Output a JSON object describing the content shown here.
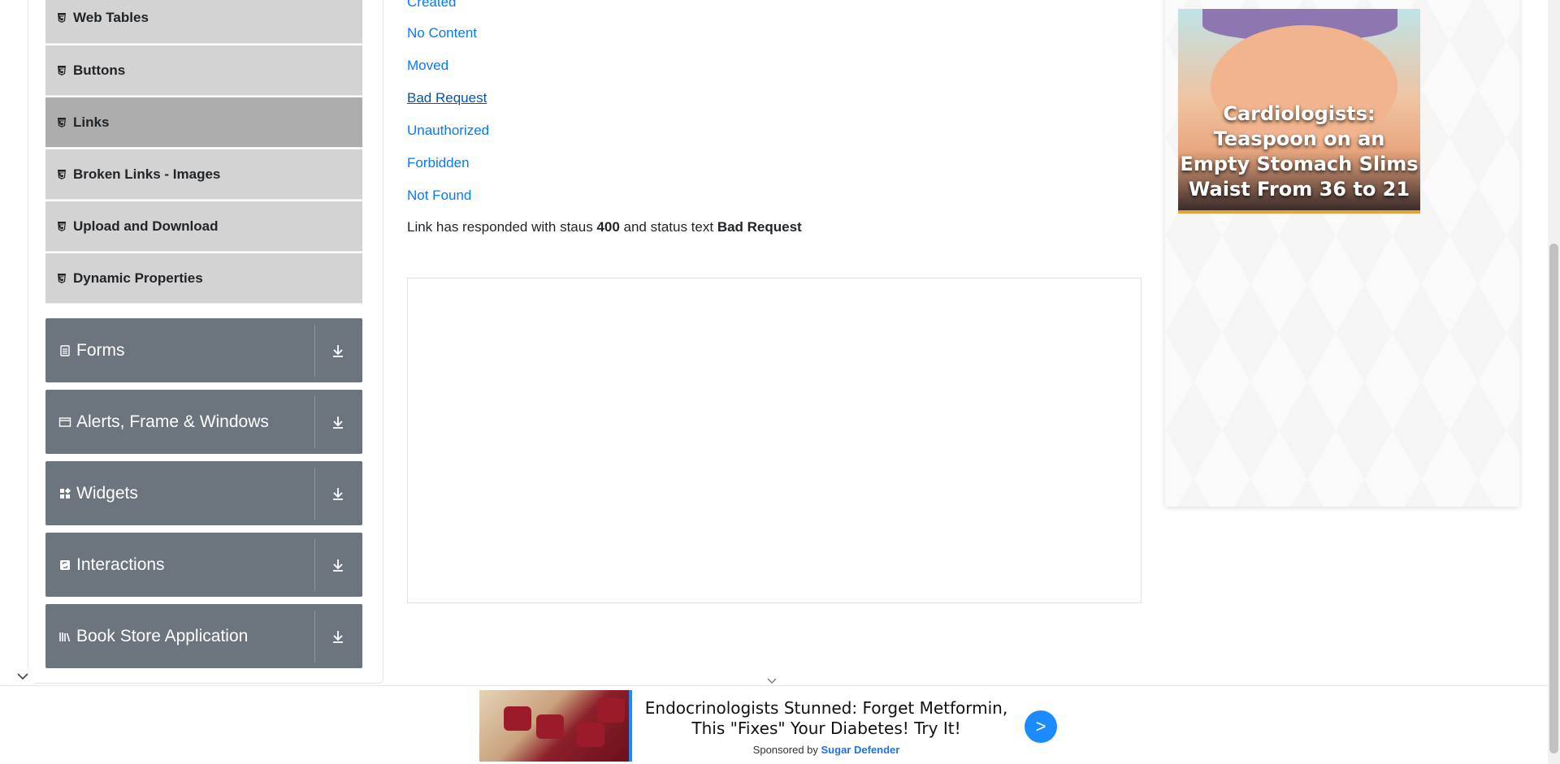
{
  "sidebar": {
    "items": [
      {
        "label": "Web Tables"
      },
      {
        "label": "Buttons"
      },
      {
        "label": "Links"
      },
      {
        "label": "Broken Links - Images"
      },
      {
        "label": "Upload and Download"
      },
      {
        "label": "Dynamic Properties"
      }
    ],
    "active_item": "Links",
    "groups": [
      {
        "label": "Forms",
        "icon": "form-icon"
      },
      {
        "label": "Alerts, Frame & Windows",
        "icon": "window-icon"
      },
      {
        "label": "Widgets",
        "icon": "widgets-icon"
      },
      {
        "label": "Interactions",
        "icon": "interactions-icon"
      },
      {
        "label": "Book Store Application",
        "icon": "books-icon"
      }
    ]
  },
  "main": {
    "links": [
      {
        "label": "Created"
      },
      {
        "label": "No Content"
      },
      {
        "label": "Moved"
      },
      {
        "label": "Bad Request"
      },
      {
        "label": "Unauthorized"
      },
      {
        "label": "Forbidden"
      },
      {
        "label": "Not Found"
      }
    ],
    "response": {
      "prefix": "Link has responded with staus ",
      "status_code": "400",
      "middle": " and status text ",
      "status_text": "Bad Request"
    }
  },
  "side_ad": {
    "text": "Cardiologists: Teaspoon on an Empty Stomach Slims Waist From 36 to 21"
  },
  "bottom_ad": {
    "title": "Endocrinologists Stunned: Forget Metformin, This \"Fixes\" Your Diabetes! Try It!",
    "sponsored_prefix": "Sponsored by ",
    "sponsor": "Sugar Defender",
    "go_label": ">"
  },
  "colors": {
    "link": "#007bff",
    "group_header": "#6c757d",
    "menu_item": "#d3d3d3",
    "menu_item_active": "#adadad",
    "ad_button": "#1a8cff"
  }
}
